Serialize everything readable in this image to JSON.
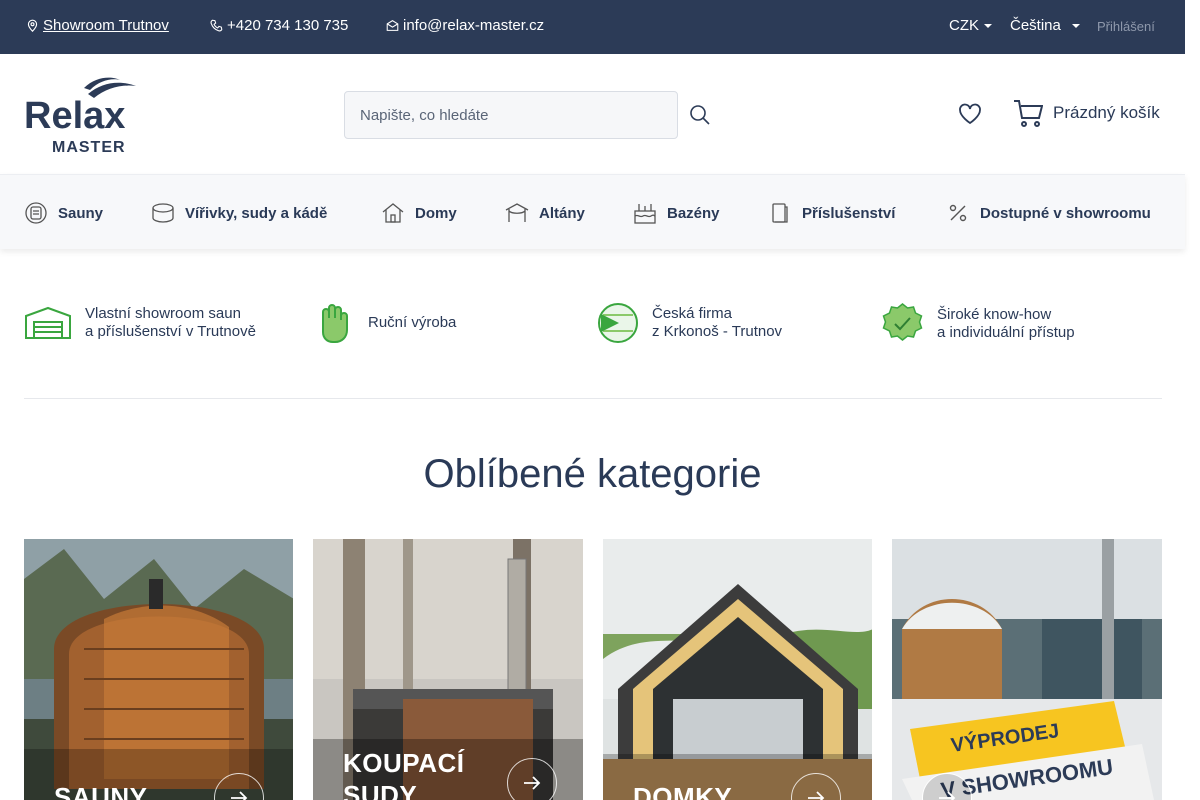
{
  "topbar": {
    "showroom": "Showroom Trutnov",
    "phone": "+420 734 130 735",
    "email": "info@relax-master.cz",
    "currency": "CZK",
    "language": "Čeština",
    "login": "Přihlášení"
  },
  "header": {
    "logo_text_1": "Relax",
    "logo_text_2": "MASTER",
    "search_placeholder": "Napište, co hledáte",
    "cart_label": "Prázdný košík"
  },
  "nav": {
    "items": [
      {
        "label": "Sauny",
        "icon": "sauna-icon"
      },
      {
        "label": "Vířivky, sudy a kádě",
        "icon": "tub-icon"
      },
      {
        "label": "Domy",
        "icon": "house-icon"
      },
      {
        "label": "Altány",
        "icon": "gazebo-icon"
      },
      {
        "label": "Bazény",
        "icon": "pool-icon"
      },
      {
        "label": "Příslušenství",
        "icon": "accessory-icon"
      },
      {
        "label": "Dostupné v showroomu",
        "icon": "percent-icon"
      }
    ]
  },
  "usps": [
    {
      "line1": "Vlastní showroom saun",
      "line2": "a příslušenství v Trutnově",
      "icon": "garage-icon"
    },
    {
      "line1": "Ruční výroba",
      "line2": "",
      "icon": "hand-icon"
    },
    {
      "line1": "Česká firma",
      "line2": "z Krkonoš - Trutnov",
      "icon": "flag-icon"
    },
    {
      "line1": "Široké know-how",
      "line2": "a individuální přístup",
      "icon": "check-badge-icon"
    }
  ],
  "categories": {
    "title": "Oblíbené kategorie",
    "items": [
      {
        "label": "SAUNY",
        "label2": ""
      },
      {
        "label": "KOUPACÍ",
        "label2": "SUDY"
      },
      {
        "label": "DOMKY",
        "label2": ""
      },
      {
        "label": "VÝPRODEJ",
        "label2": "V SHOWROOMU"
      }
    ]
  },
  "colors": {
    "brand_navy": "#2c3b57",
    "accent_green": "#4caf50",
    "banner_yellow": "#f7c520"
  }
}
